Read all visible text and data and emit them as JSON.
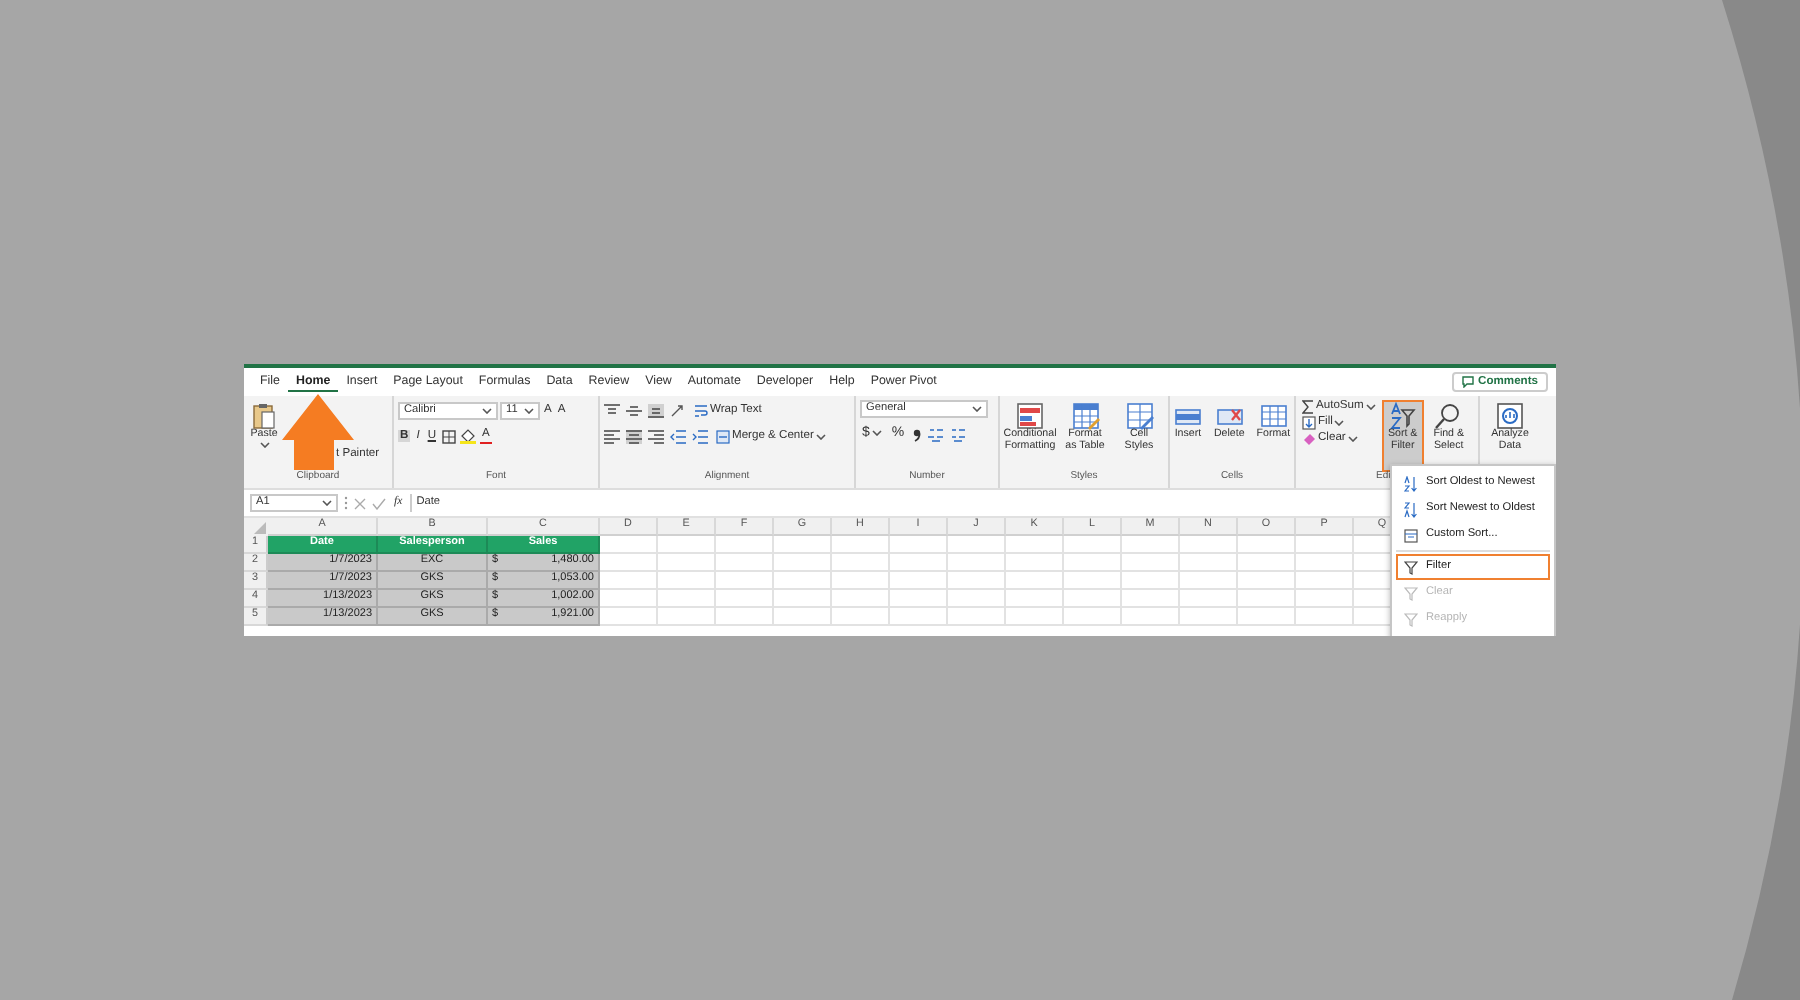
{
  "tabs": [
    {
      "label": "File",
      "selected": false
    },
    {
      "label": "Home",
      "selected": true
    },
    {
      "label": "Insert",
      "selected": false
    },
    {
      "label": "Page Layout",
      "selected": false
    },
    {
      "label": "Formulas",
      "selected": false
    },
    {
      "label": "Data",
      "selected": false
    },
    {
      "label": "Review",
      "selected": false
    },
    {
      "label": "View",
      "selected": false
    },
    {
      "label": "Automate",
      "selected": false
    },
    {
      "label": "Developer",
      "selected": false
    },
    {
      "label": "Help",
      "selected": false
    },
    {
      "label": "Power Pivot",
      "selected": false
    }
  ],
  "comments_button": "Comments",
  "ribbon": {
    "clipboard": {
      "label": "Clipboard",
      "paste": "Paste",
      "format_painter": "t Painter"
    },
    "font": {
      "label": "Font",
      "font_name": "Calibri",
      "font_size": "11",
      "grow": "A",
      "shrink": "A",
      "bold": "B",
      "italic": "I",
      "underline": "U",
      "font_color": "A"
    },
    "alignment": {
      "label": "Alignment",
      "wrap_text": "Wrap Text",
      "merge_center": "Merge & Center"
    },
    "number": {
      "label": "Number",
      "format": "General",
      "currency": "$",
      "percent": "%"
    },
    "styles": {
      "label": "Styles",
      "buttons": [
        {
          "label": "Conditional Formatting",
          "kind": "conditional"
        },
        {
          "label": "Format as Table",
          "kind": "table"
        },
        {
          "label": "Cell Styles",
          "kind": "cellstyles"
        }
      ]
    },
    "cells": {
      "label": "Cells",
      "buttons": [
        {
          "label": "Insert",
          "kind": "insert"
        },
        {
          "label": "Delete",
          "kind": "delete"
        },
        {
          "label": "Format",
          "kind": "format"
        }
      ]
    },
    "editing": {
      "label": "Edi",
      "autosum": "AutoSum",
      "fill": "Fill",
      "clear": "Clear",
      "buttons": [
        {
          "label": "Sort & Filter",
          "kind": "sortfilter",
          "highlighted": true
        },
        {
          "label": "Find & Select",
          "kind": "find",
          "highlighted": false
        }
      ]
    },
    "analysis": {
      "buttons": [
        {
          "label": "Analyze Data",
          "kind": "analyze"
        }
      ]
    }
  },
  "formula_bar": {
    "name_box": "A1",
    "function_label": "fx",
    "value": "Date"
  },
  "grid": {
    "columns": [
      "A",
      "B",
      "C",
      "D",
      "E",
      "F",
      "G",
      "H",
      "I",
      "J",
      "K",
      "L",
      "M",
      "N",
      "O",
      "P",
      "Q"
    ],
    "header_row": {
      "number": "1",
      "date": "Date",
      "salesperson": "Salesperson",
      "sales": "Sales"
    },
    "rows": [
      {
        "number": "2",
        "date": "1/7/2023",
        "salesperson": "EXC",
        "currency": "$",
        "sales": "1,480.00"
      },
      {
        "number": "3",
        "date": "1/7/2023",
        "salesperson": "GKS",
        "currency": "$",
        "sales": "1,053.00"
      },
      {
        "number": "4",
        "date": "1/13/2023",
        "salesperson": "GKS",
        "currency": "$",
        "sales": "1,002.00"
      },
      {
        "number": "5",
        "date": "1/13/2023",
        "salesperson": "GKS",
        "currency": "$",
        "sales": "1,921.00"
      }
    ]
  },
  "sort_filter_menu": {
    "items": [
      {
        "label": "Sort Oldest to Newest",
        "kind": "sort-asc",
        "disabled": false,
        "highlighted": false
      },
      {
        "label": "Sort Newest to Oldest",
        "kind": "sort-desc",
        "disabled": false,
        "highlighted": false
      },
      {
        "label": "Custom Sort...",
        "kind": "custom",
        "disabled": false,
        "highlighted": false
      },
      {
        "label": "Filter",
        "kind": "filter",
        "disabled": false,
        "highlighted": true
      },
      {
        "label": "Clear",
        "kind": "clear",
        "disabled": true,
        "highlighted": false
      },
      {
        "label": "Reapply",
        "kind": "reapply",
        "disabled": true,
        "highlighted": false
      }
    ]
  }
}
